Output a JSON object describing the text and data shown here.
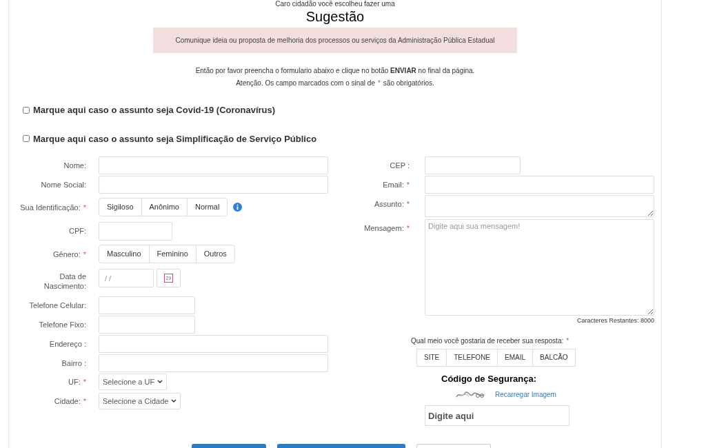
{
  "header": {
    "intro": "Caro cidadão você escolheu fazer uma",
    "title": "Sugestão",
    "notice": "Comunique ideia ou proposta de melhoria dos processos ou serviços da Administração Pública Estadual",
    "instructions": "Então por favor preencha o formulario abaixo e clique no botão **ENVIAR** no final da página.",
    "attention": "Atenção. Os campo marcados com o sinal de",
    "required_mark": "*",
    "attention_end": "são obrigatórios."
  },
  "checkboxes": [
    {
      "label": "Marque aqui caso o assunto seja Covid-19 (Coronavírus)",
      "checked": false
    },
    {
      "label": "Marque aqui caso o assunto seja Simplificação de Serviço Público",
      "checked": false
    }
  ],
  "left_fields": [
    {
      "kind": "text",
      "label": "Nome:",
      "required": false
    },
    {
      "kind": "text",
      "label": "Nome Social:",
      "required": false
    },
    {
      "kind": "toggle",
      "label": "Sua Identificação:",
      "required": true,
      "info": true,
      "options": [
        {
          "label": "Sigiloso",
          "selected": false
        },
        {
          "label": "Anônimo",
          "selected": false
        },
        {
          "label": "Normal",
          "selected": false
        }
      ]
    },
    {
      "kind": "short",
      "label": "CPF:",
      "required": false
    },
    {
      "kind": "toggle",
      "label": "Gênero:",
      "required": true,
      "info": false,
      "options": [
        {
          "label": "Masculino",
          "selected": false
        },
        {
          "label": "Feminino",
          "selected": false
        },
        {
          "label": "Outros",
          "selected": false
        }
      ]
    },
    {
      "kind": "date",
      "label": "Data de Nascimento:",
      "required": false,
      "placeholder": "/ /",
      "calendar_day": "29"
    },
    {
      "kind": "phone",
      "label": "Telefone Celular:",
      "required": false
    },
    {
      "kind": "phone",
      "label": "Telefone Fixo:",
      "required": false
    },
    {
      "kind": "text",
      "label": "Endereço :",
      "required": false
    },
    {
      "kind": "text",
      "label": "Bairro :",
      "required": false
    },
    {
      "kind": "select",
      "label": "UF:",
      "required": true,
      "value": "Selecione a UF"
    },
    {
      "kind": "select",
      "label": "Cidade:",
      "required": true,
      "value": "Selecione a Cidade"
    }
  ],
  "right_fields": [
    {
      "kind": "short",
      "label": "CEP :",
      "required": false
    },
    {
      "kind": "text",
      "label": "Email:",
      "required": true
    },
    {
      "kind": "textarea",
      "label": "Assunto:",
      "required": true
    },
    {
      "kind": "message",
      "label": "Mensagem:",
      "required": true,
      "placeholder": "Digite aqui sua mensagem!",
      "counter": "Caracteres Restantes: 8000"
    }
  ],
  "reply": {
    "question": "Qual meio você gostaria de receber sua resposta:",
    "required": true,
    "options": [
      {
        "label": "SITE",
        "selected": false
      },
      {
        "label": "TELEFONE",
        "selected": false
      },
      {
        "label": "EMAIL",
        "selected": false
      },
      {
        "label": "BALCÃO",
        "selected": false
      }
    ]
  },
  "security": {
    "title": "Código de Segurança:",
    "reload_link": "Recarregar Imagem",
    "placeholder": "Digite aqui"
  },
  "bottom_buttons": [
    {
      "kind": "primary"
    },
    {
      "kind": "primary"
    },
    {
      "kind": "secondary"
    }
  ]
}
